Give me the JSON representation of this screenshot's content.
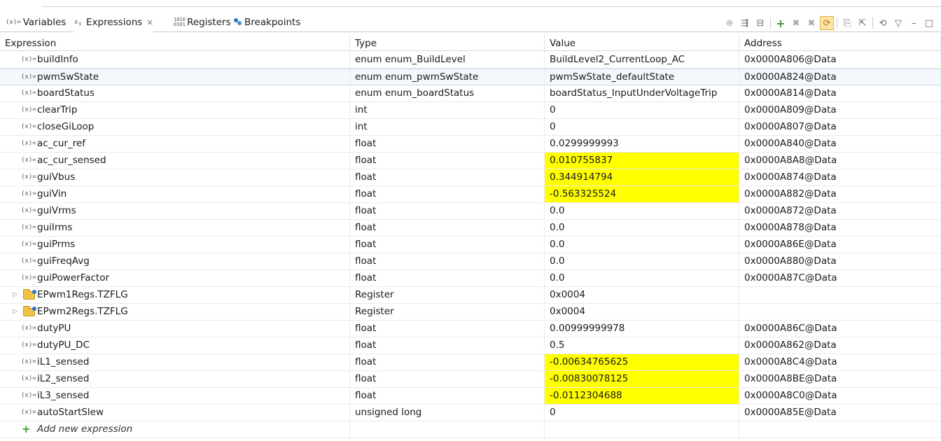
{
  "tabs": [
    {
      "label": "Variables",
      "icon": "(x)="
    },
    {
      "label": "Expressions",
      "icon": "x-y-icon",
      "close": "✕"
    },
    {
      "label": "Registers",
      "icon": "1010"
    },
    {
      "label": "Breakpoints",
      "icon": "breakpoint-icon"
    }
  ],
  "columns": {
    "expression": "Expression",
    "type": "Type",
    "value": "Value",
    "address": "Address"
  },
  "var_icon": "(x)=",
  "rows": [
    {
      "expression": "buildInfo",
      "type": "enum enum_BuildLevel",
      "value": "BuildLevel2_CurrentLoop_AC",
      "address": "0x0000A806@Data"
    },
    {
      "expression": "pwmSwState",
      "type": "enum enum_pwmSwState",
      "value": "pwmSwState_defaultState",
      "address": "0x0000A824@Data"
    },
    {
      "expression": "boardStatus",
      "type": "enum enum_boardStatus",
      "value": "boardStatus_InputUnderVoltageTrip",
      "address": "0x0000A814@Data"
    },
    {
      "expression": "clearTrip",
      "type": "int",
      "value": "0",
      "address": "0x0000A809@Data"
    },
    {
      "expression": "closeGiLoop",
      "type": "int",
      "value": "0",
      "address": "0x0000A807@Data"
    },
    {
      "expression": "ac_cur_ref",
      "type": "float",
      "value": "0.0299999993",
      "address": "0x0000A840@Data"
    },
    {
      "expression": "ac_cur_sensed",
      "type": "float",
      "value": "0.010755837",
      "address": "0x0000A8A8@Data"
    },
    {
      "expression": "guiVbus",
      "type": "float",
      "value": "0.344914794",
      "address": "0x0000A874@Data"
    },
    {
      "expression": "guiVin",
      "type": "float",
      "value": "-0.563325524",
      "address": "0x0000A882@Data"
    },
    {
      "expression": "guiVrms",
      "type": "float",
      "value": "0.0",
      "address": "0x0000A872@Data"
    },
    {
      "expression": "guiIrms",
      "type": "float",
      "value": "0.0",
      "address": "0x0000A878@Data"
    },
    {
      "expression": "guiPrms",
      "type": "float",
      "value": "0.0",
      "address": "0x0000A86E@Data"
    },
    {
      "expression": "guiFreqAvg",
      "type": "float",
      "value": "0.0",
      "address": "0x0000A880@Data"
    },
    {
      "expression": "guiPowerFactor",
      "type": "float",
      "value": "0.0",
      "address": "0x0000A87C@Data"
    },
    {
      "expression": "EPwm1Regs.TZFLG",
      "type": "Register",
      "value": "0x0004",
      "address": ""
    },
    {
      "expression": "EPwm2Regs.TZFLG",
      "type": "Register",
      "value": "0x0004",
      "address": ""
    },
    {
      "expression": "dutyPU",
      "type": "float",
      "value": "0.00999999978",
      "address": "0x0000A86C@Data"
    },
    {
      "expression": "dutyPU_DC",
      "type": "float",
      "value": "0.5",
      "address": "0x0000A862@Data"
    },
    {
      "expression": "iL1_sensed",
      "type": "float",
      "value": "-0.00634765625",
      "address": "0x0000A8C4@Data"
    },
    {
      "expression": "iL2_sensed",
      "type": "float",
      "value": "-0.00830078125",
      "address": "0x0000A8BE@Data"
    },
    {
      "expression": "iL3_sensed",
      "type": "float",
      "value": "-0.0112304688",
      "address": "0x0000A8C0@Data"
    },
    {
      "expression": "autoStartSlew",
      "type": "unsigned long",
      "value": "0",
      "address": "0x0000A85E@Data"
    }
  ],
  "add_expression": "Add new expression",
  "highlight_color": "#ffff00"
}
